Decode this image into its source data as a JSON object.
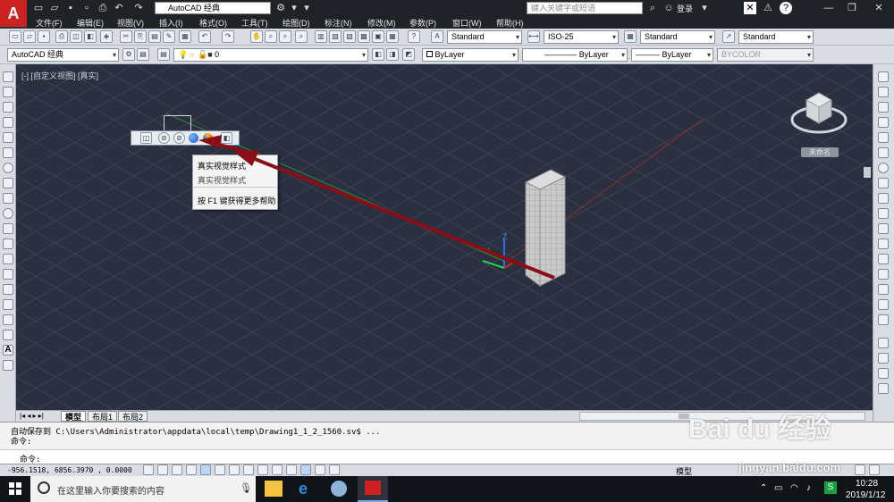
{
  "app": {
    "logo_text": "A",
    "workspace_top": "AutoCAD 经典",
    "search_placeholder": "键入关键字或短语",
    "login": "登录"
  },
  "menu": [
    "文件(F)",
    "编辑(E)",
    "视图(V)",
    "插入(I)",
    "格式(O)",
    "工具(T)",
    "绘图(D)",
    "标注(N)",
    "修改(M)",
    "参数(P)",
    "窗口(W)",
    "帮助(H)"
  ],
  "styles_toolbar": {
    "text_style": "Standard",
    "dim_style": "ISO-25",
    "table_style": "Standard",
    "mleader_style": "Standard"
  },
  "layers_toolbar": {
    "workspace": "AutoCAD 经典",
    "layer": "0",
    "color": "ByLayer",
    "linetype": "ByLayer",
    "lineweight": "ByLayer",
    "plotstyle": "BYCOLOR"
  },
  "viewport": {
    "label": "[-] [自定义视图] [真实]",
    "viewcube_text": "未命名",
    "axis_z": "Z",
    "axis_y": "Y"
  },
  "context_menu": {
    "items": [
      "真实视觉样式",
      "真实视觉样式",
      "按 F1 键获得更多帮助"
    ]
  },
  "layout_tabs": [
    "模型",
    "布局1",
    "布局2"
  ],
  "command": {
    "line1": "自动保存到 C:\\Users\\Administrator\\appdata\\local\\temp\\Drawing1_1_2_1560.sv$ ...",
    "line2": "命令:",
    "prompt": "命令:"
  },
  "status": {
    "coords": "-956.1518,  6856.3970 , 0.0000",
    "model": "模型"
  },
  "taskbar": {
    "search_placeholder": "在这里输入你要搜索的内容",
    "time": "10:28",
    "date": "2019/1/12"
  },
  "watermark": {
    "brand": "Bai du 经验",
    "url": "jingyan.baidu.com"
  },
  "colors": {
    "arrow": "#8b0d15",
    "viewport_bg": "#2b3040",
    "grid": "#3b4152"
  }
}
